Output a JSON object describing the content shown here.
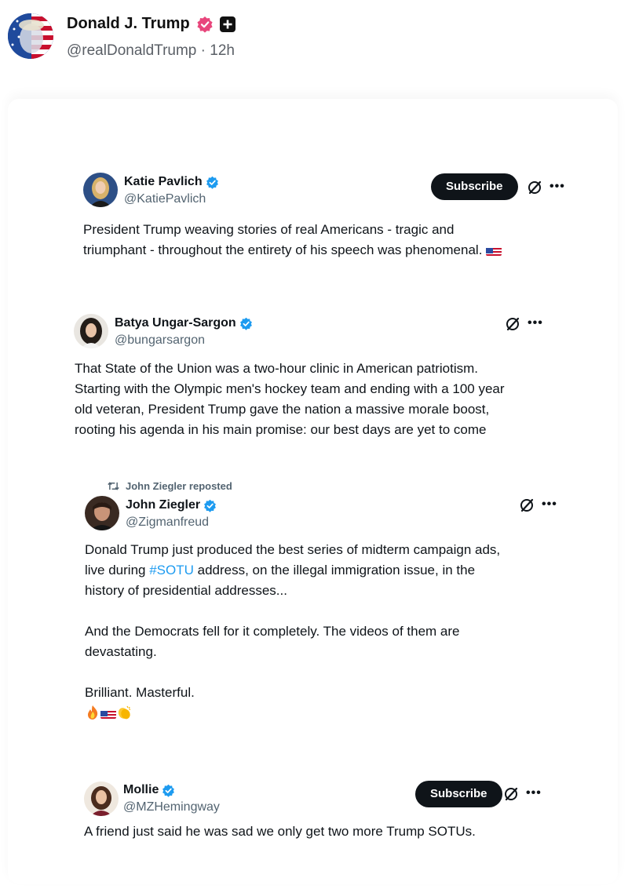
{
  "post": {
    "author_name": "Donald J. Trump",
    "handle": "@realDonaldTrump",
    "separator": "·",
    "time": "12h"
  },
  "tweets": [
    {
      "name": "Katie Pavlich",
      "handle": "@KatiePavlich",
      "subscribe_label": "Subscribe",
      "lines": [
        "President Trump weaving stories of real Americans - tragic and",
        "triumphant - throughout the entirety of his speech was phenomenal."
      ]
    },
    {
      "name": "Batya Ungar-Sargon",
      "handle": "@bungarsargon",
      "lines": [
        "That State of the Union was a two-hour clinic in American patriotism.",
        "Starting with the Olympic men's hockey team and ending with a 100 year",
        "old veteran, President Trump gave the nation a massive morale boost,",
        "rooting his agenda in his main promise: our best days are yet to come"
      ]
    },
    {
      "repost_label": "John Ziegler reposted",
      "name": "John Ziegler",
      "handle": "@Zigmanfreud",
      "line1": "Donald Trump just produced the best series of midterm campaign ads,",
      "line2_before": "live during ",
      "hashtag": "#SOTU",
      "line2_after": " address, on the illegal immigration issue, in the",
      "line3": "history of presidential addresses...",
      "line4": "And the Democrats fell for it completely. The videos of them are",
      "line5": "devastating.",
      "line6": "Brilliant. Masterful."
    },
    {
      "name": "Mollie",
      "handle": "@MZHemingway",
      "subscribe_label": "Subscribe",
      "lines": [
        "A friend just said he was sad we only get two more Trump SOTUs."
      ]
    }
  ],
  "icons": {
    "verified": "verified-badge-icon",
    "grok": "grok-icon",
    "more": "more-options-icon",
    "repost": "repost-icon"
  },
  "colors": {
    "verified_blue": "#1d9bf0",
    "truth_badge_pink": "#e8467c",
    "hashtag_blue": "#1d9bf0",
    "subscribe_bg": "#0f1419"
  }
}
